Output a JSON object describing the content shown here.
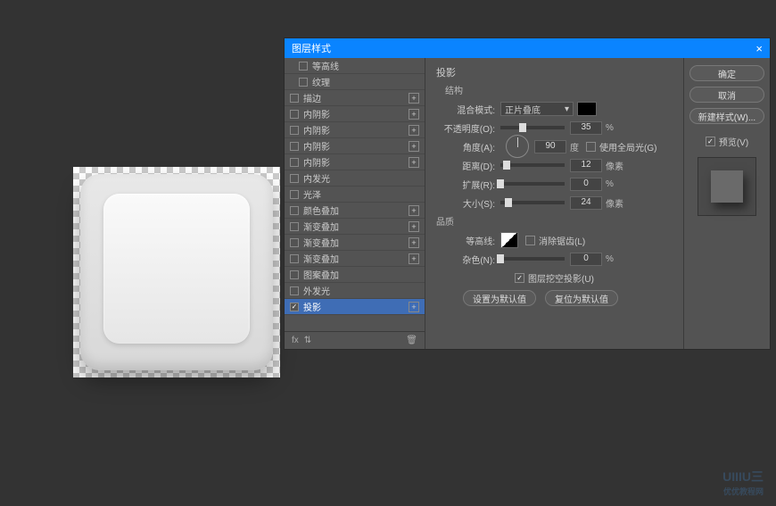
{
  "dialog": {
    "title": "图层样式",
    "close": "×"
  },
  "styles": [
    {
      "label": "等高线",
      "checked": false,
      "indent": true
    },
    {
      "label": "纹理",
      "checked": false,
      "indent": true
    },
    {
      "label": "描边",
      "checked": false,
      "plus": true
    },
    {
      "label": "内阴影",
      "checked": false,
      "plus": true
    },
    {
      "label": "内阴影",
      "checked": false,
      "plus": true
    },
    {
      "label": "内阴影",
      "checked": false,
      "plus": true
    },
    {
      "label": "内阴影",
      "checked": false,
      "plus": true
    },
    {
      "label": "内发光",
      "checked": false
    },
    {
      "label": "光泽",
      "checked": false
    },
    {
      "label": "颜色叠加",
      "checked": false,
      "plus": true
    },
    {
      "label": "渐变叠加",
      "checked": false,
      "plus": true
    },
    {
      "label": "渐变叠加",
      "checked": false,
      "plus": true
    },
    {
      "label": "渐变叠加",
      "checked": false,
      "plus": true
    },
    {
      "label": "图案叠加",
      "checked": false
    },
    {
      "label": "外发光",
      "checked": false
    },
    {
      "label": "投影",
      "checked": true,
      "plus": true,
      "selected": true
    }
  ],
  "footer": {
    "fx": "fx",
    "trash": "🗑"
  },
  "settings": {
    "section_title": "投影",
    "structure_title": "结构",
    "blend_label": "混合模式:",
    "blend_value": "正片叠底",
    "opacity_label": "不透明度(O):",
    "opacity_value": "35",
    "opacity_unit": "%",
    "angle_label": "角度(A):",
    "angle_value": "90",
    "angle_unit": "度",
    "global_light": "使用全局光(G)",
    "distance_label": "距离(D):",
    "distance_value": "12",
    "distance_unit": "像素",
    "spread_label": "扩展(R):",
    "spread_value": "0",
    "spread_unit": "%",
    "size_label": "大小(S):",
    "size_value": "24",
    "size_unit": "像素",
    "quality_title": "品质",
    "contour_label": "等高线:",
    "antialias": "消除锯齿(L)",
    "noise_label": "杂色(N):",
    "noise_value": "0",
    "noise_unit": "%",
    "knockout": "图层挖空投影(U)",
    "make_default": "设置为默认值",
    "reset_default": "复位为默认值"
  },
  "right": {
    "ok": "确定",
    "cancel": "取消",
    "new_style": "新建样式(W)...",
    "preview": "预览(V)"
  },
  "watermark": "优优教程网"
}
